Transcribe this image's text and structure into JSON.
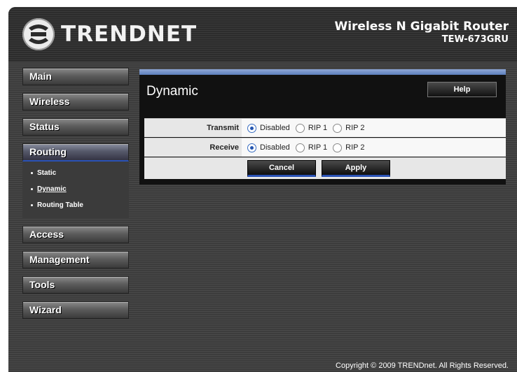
{
  "header": {
    "brand": "TRENDNET",
    "product_name": "Wireless N Gigabit Router",
    "product_model": "TEW-673GRU"
  },
  "sidebar": {
    "items": [
      {
        "label": "Main"
      },
      {
        "label": "Wireless"
      },
      {
        "label": "Status"
      },
      {
        "label": "Routing",
        "active": true
      },
      {
        "label": "Access"
      },
      {
        "label": "Management"
      },
      {
        "label": "Tools"
      },
      {
        "label": "Wizard"
      }
    ],
    "routing_sub": [
      {
        "label": "Static"
      },
      {
        "label": "Dynamic",
        "current": true
      },
      {
        "label": "Routing Table"
      }
    ]
  },
  "panel": {
    "title": "Dynamic",
    "help_label": "Help",
    "transmit": {
      "label": "Transmit",
      "options": [
        "Disabled",
        "RIP 1",
        "RIP 2"
      ],
      "selected": "Disabled"
    },
    "receive": {
      "label": "Receive",
      "options": [
        "Disabled",
        "RIP 1",
        "RIP 2"
      ],
      "selected": "Disabled"
    },
    "cancel_label": "Cancel",
    "apply_label": "Apply"
  },
  "footer": {
    "copyright": "Copyright © 2009 TRENDnet. All Rights Reserved."
  },
  "colors": {
    "accent_blue": "#2a52b6",
    "panel_bar": "#6f8ec9",
    "background": "#3c3c3c"
  }
}
